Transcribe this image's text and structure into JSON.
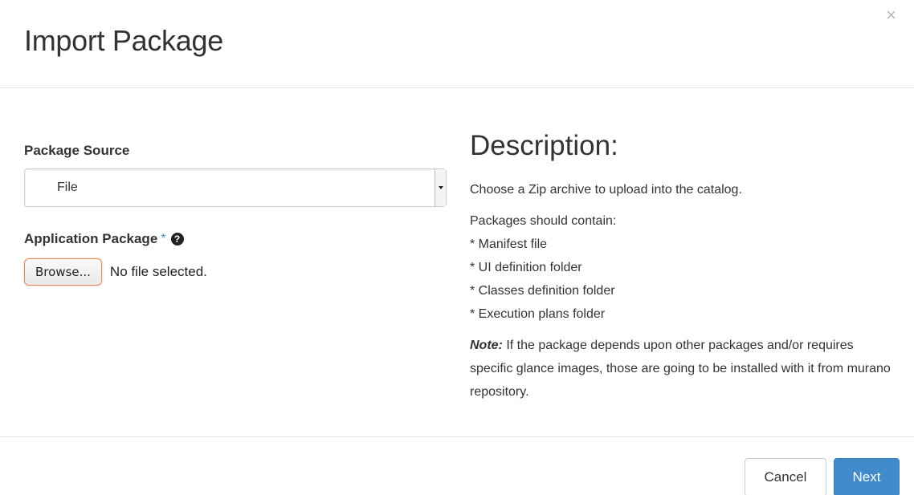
{
  "modal": {
    "title": "Import Package",
    "close_glyph": "×"
  },
  "form": {
    "package_source": {
      "label": "Package Source",
      "selected": "File"
    },
    "application_package": {
      "label": "Application Package",
      "required_mark": "*",
      "help_glyph": "?",
      "browse_label": "Browse...",
      "file_status": "No file selected."
    }
  },
  "description": {
    "title": "Description:",
    "intro": "Choose a Zip archive to upload into the catalog.",
    "list_heading": "Packages should contain:",
    "items": [
      "* Manifest file",
      "* UI definition folder",
      "* Classes definition folder",
      "* Execution plans folder"
    ],
    "note_label": "Note:",
    "note_text": " If the package depends upon other packages and/or requires specific glance images, those are going to be installed with it from murano repository."
  },
  "footer": {
    "cancel_label": "Cancel",
    "next_label": "Next"
  },
  "colors": {
    "primary": "#428bca",
    "browse_border": "#e68a5a",
    "text": "#333333"
  }
}
